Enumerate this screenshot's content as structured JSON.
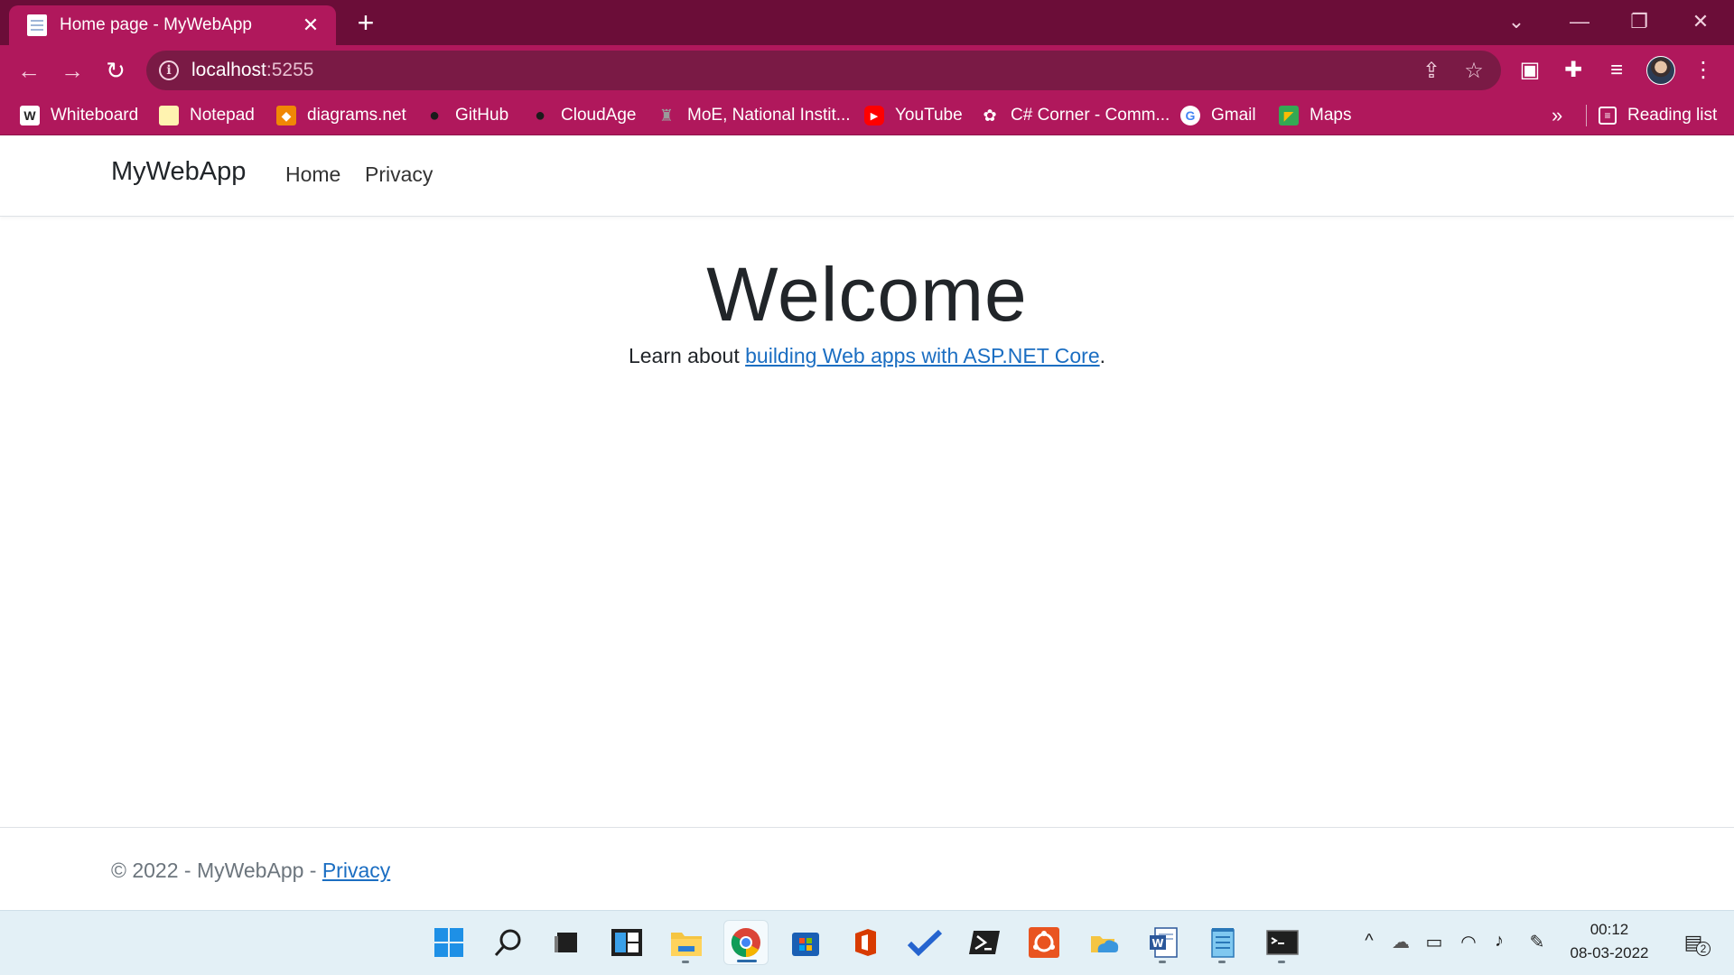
{
  "browser": {
    "tab_title": "Home page - MyWebApp",
    "tab_close": "✕",
    "new_tab": "+",
    "url_host": "localhost",
    "url_port": ":5255",
    "window_controls": {
      "dropdown": "⌄",
      "minimize": "—",
      "restore": "❐",
      "close": "✕"
    },
    "nav": {
      "back": "←",
      "forward": "→",
      "reload": "↻"
    },
    "omnibox_icons": {
      "share": "⇪",
      "star": "☆"
    },
    "toolbar_icons": {
      "screencast": "▣",
      "extensions": "✚",
      "media": "≡",
      "menu": "⋮"
    },
    "bookmarks": [
      {
        "label": "Whiteboard",
        "icon": "W",
        "icon_color": "#ffffff",
        "icon_bg": "#ffffff",
        "icon_fg": "#222222"
      },
      {
        "label": "Notepad",
        "icon": "",
        "icon_bg": "#fff3b0",
        "icon_fg": "#222222"
      },
      {
        "label": "diagrams.net",
        "icon": "◆",
        "icon_bg": "#f08705",
        "icon_fg": "#ffffff"
      },
      {
        "label": "GitHub",
        "icon": "●",
        "icon_bg": "#b0185c",
        "icon_fg": "#1b1b1b"
      },
      {
        "label": "CloudAge",
        "icon": "●",
        "icon_bg": "#b0185c",
        "icon_fg": "#1b1b1b"
      },
      {
        "label": "MoE, National Instit...",
        "icon": "♜",
        "icon_bg": "#b0185c",
        "icon_fg": "#9a9a9a"
      },
      {
        "label": "YouTube",
        "icon": "▶",
        "icon_bg": "#ff0000",
        "icon_fg": "#ffffff"
      },
      {
        "label": "C# Corner - Comm...",
        "icon": "✿",
        "icon_bg": "#b0185c",
        "icon_fg": "#ffffff"
      },
      {
        "label": "Gmail",
        "icon": "G",
        "icon_bg": "#ffffff",
        "icon_fg": "#4285f4"
      },
      {
        "label": "Maps",
        "icon": "◤",
        "icon_bg": "#34a853",
        "icon_fg": "#fbbc04"
      }
    ],
    "bookmarks_more": "»",
    "reading_list": "Reading list"
  },
  "page": {
    "brand": "MyWebApp",
    "nav_links": [
      "Home",
      "Privacy"
    ],
    "heading": "Welcome",
    "learn_prefix": "Learn about ",
    "learn_link": "building Web apps with ASP.NET Core",
    "learn_suffix": ".",
    "footer_text": "© 2022 - MyWebApp - ",
    "footer_link": "Privacy"
  },
  "taskbar": {
    "apps": [
      "start-icon",
      "search-icon",
      "task-view-icon",
      "widgets-icon",
      "file-explorer-icon",
      "chrome-icon",
      "store-icon",
      "office-icon",
      "todo-icon",
      "powershell-icon",
      "ubuntu-icon",
      "onedrive-icon",
      "word-icon",
      "notepad-icon",
      "terminal-icon"
    ],
    "tray_icons": {
      "overflow": "^",
      "onedrive": "☁",
      "battery": "▭",
      "wifi": "◠",
      "volume": "♪",
      "pen": "✎"
    },
    "time": "00:12",
    "date": "08-03-2022",
    "notification_count": "2"
  },
  "colors": {
    "titlebar": "#6b0d38",
    "toolbar": "#b0185c",
    "link": "#1b6ec2",
    "taskbar": "#e3f0f6"
  }
}
